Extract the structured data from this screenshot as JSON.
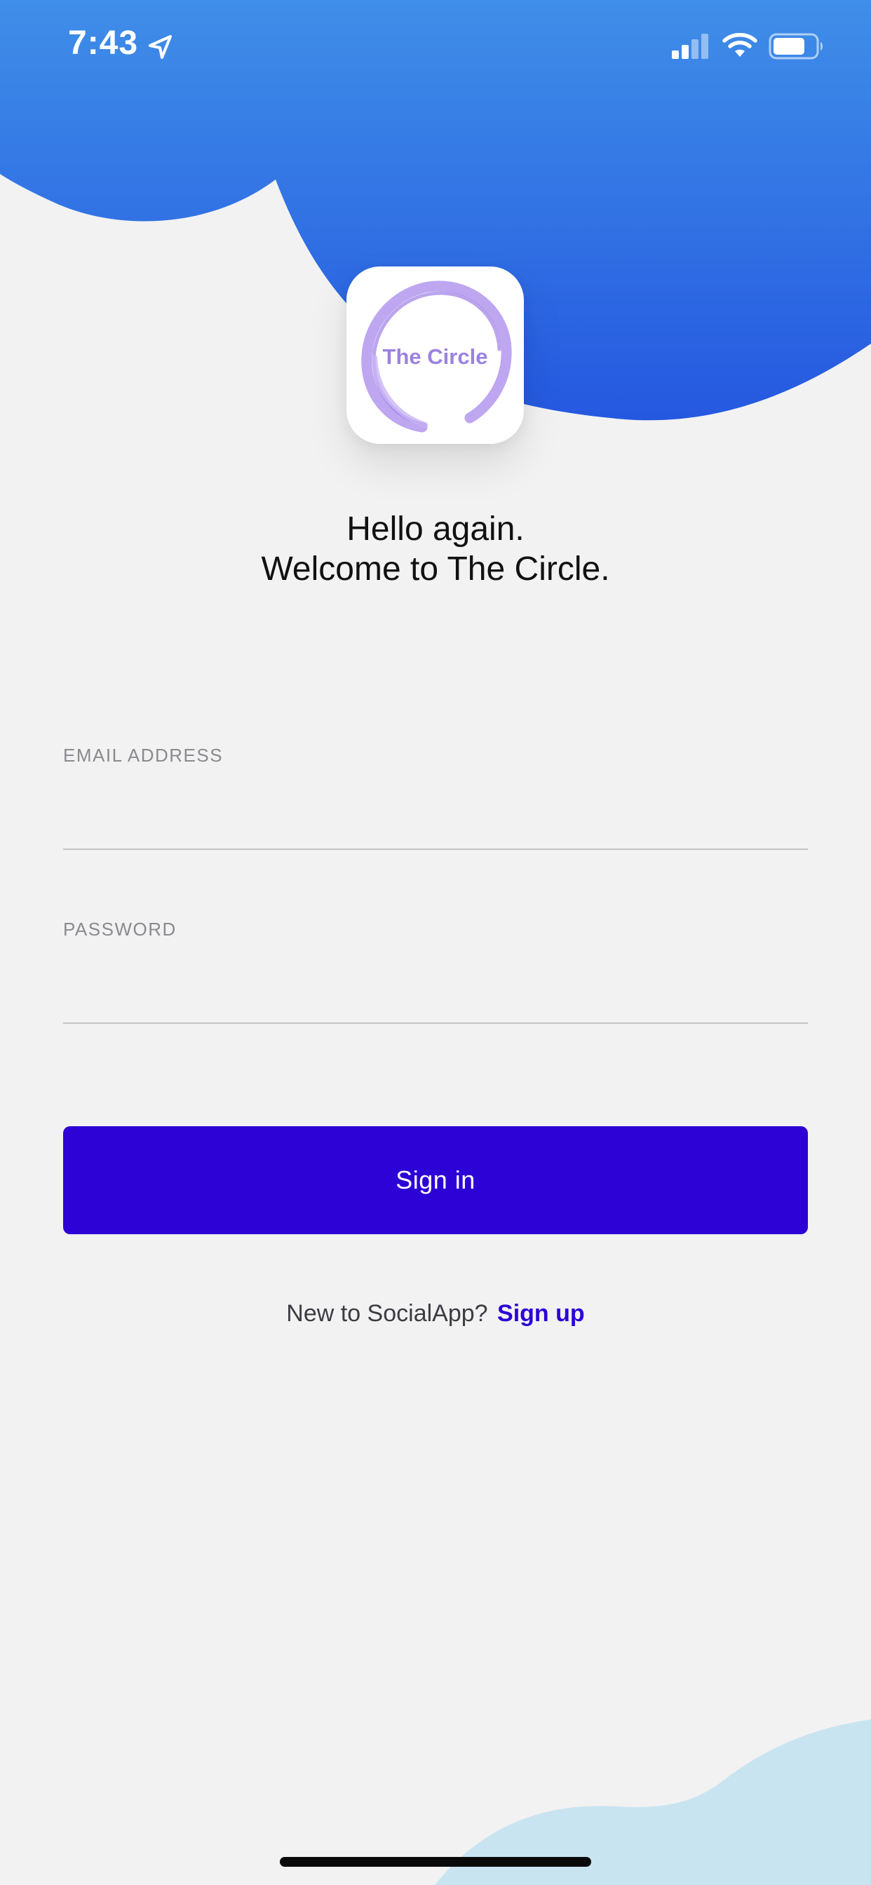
{
  "status_bar": {
    "time": "7:43",
    "icons": [
      "location-arrow-icon",
      "cellular-signal-icon",
      "wifi-icon",
      "battery-icon"
    ]
  },
  "logo": {
    "text": "The Circle"
  },
  "welcome": {
    "line1": "Hello again.",
    "line2": "Welcome to The Circle."
  },
  "form": {
    "email_label": "EMAIL ADDRESS",
    "email_value": "",
    "password_label": "PASSWORD",
    "password_value": ""
  },
  "sign_in_button": {
    "label": "Sign in"
  },
  "sign_up": {
    "prompt": "New to SocialApp?",
    "link_label": "Sign up"
  },
  "colors": {
    "header_blue": "#2f6fe4",
    "button_purple": "#2c02d6",
    "link_purple": "#2c02d6",
    "background": "#f2f2f2",
    "bottom_wave": "#c9e4f1",
    "logo_ring": "#b79cf0"
  }
}
